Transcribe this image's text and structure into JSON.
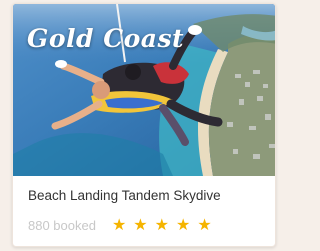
{
  "card": {
    "location": "Gold Coast",
    "title": "Beach Landing Tandem Skydive",
    "booked": "880 booked",
    "rating": 5,
    "rating_max": 5
  },
  "colors": {
    "star": "#f5b400",
    "booked_text": "#c8c8c8",
    "title_text": "#333333"
  }
}
